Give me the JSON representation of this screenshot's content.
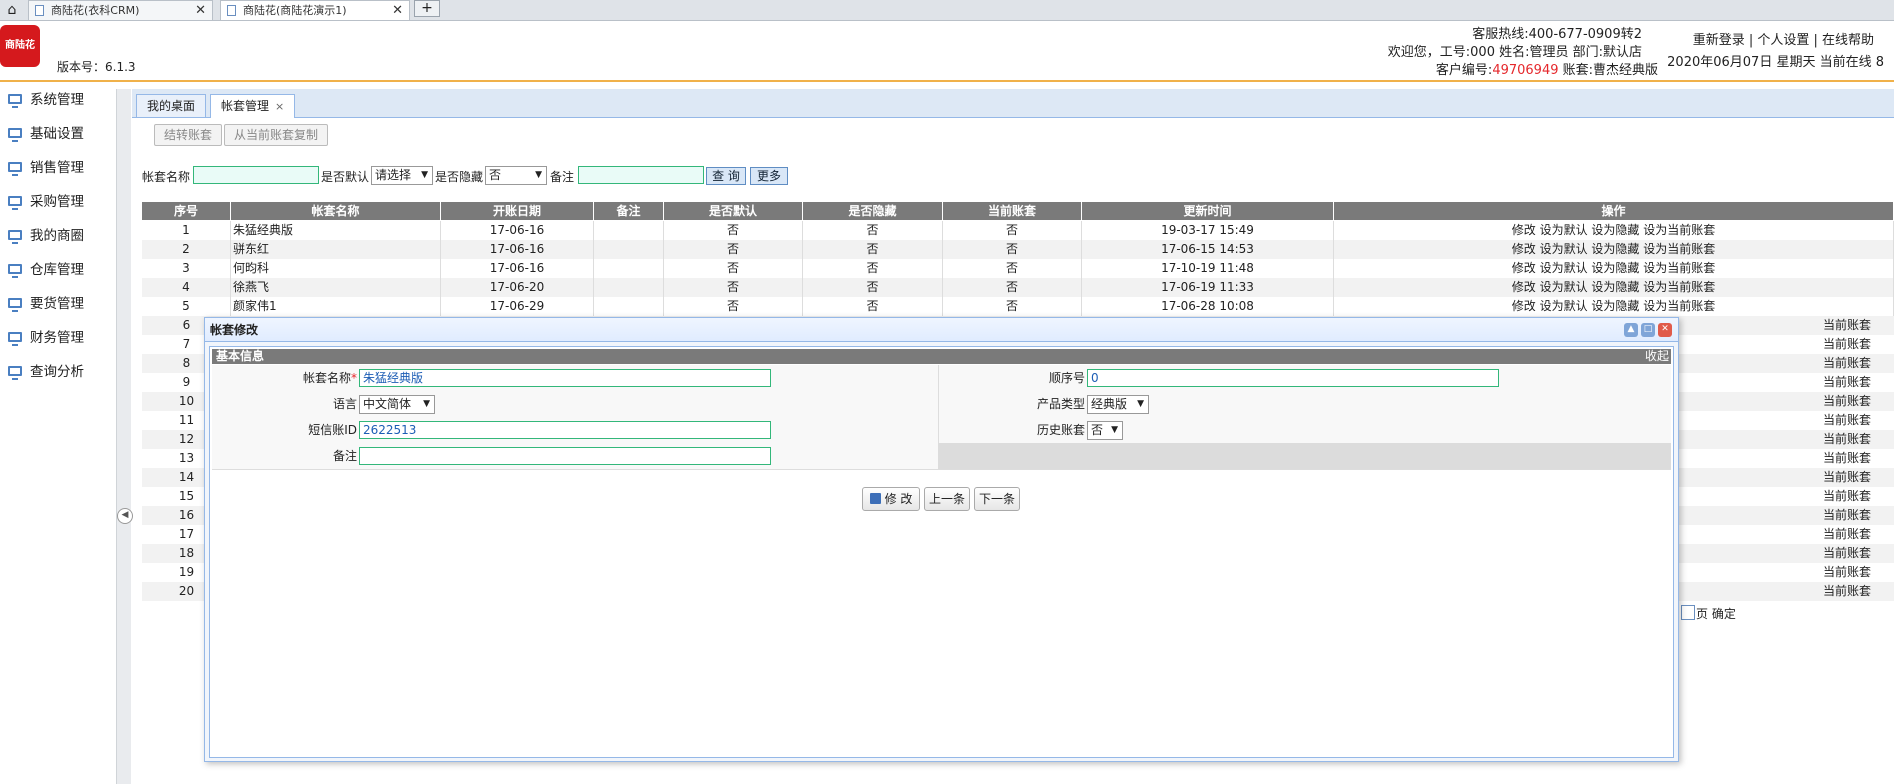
{
  "browser": {
    "tabs": [
      {
        "title": "商陆花(衣科CRM)",
        "active": false
      },
      {
        "title": "商陆花(商陆花演示1)",
        "active": true
      }
    ],
    "new_tab": "+"
  },
  "header": {
    "logo_text": "商陆花",
    "version": "版本号：6.1.3",
    "hotline": "客服热线:400-677-0909转2",
    "welcome": "欢迎您，工号:000 姓名:管理员 部门:默认店",
    "customer_prefix": "客户编号:",
    "customer_id": "49706949",
    "account_set": " 账套:曹杰经典版",
    "links": "重新登录 | 个人设置 | 在线帮助",
    "date_line": "2020年06月07日 星期天 当前在线 8"
  },
  "sidebar": {
    "items": [
      "系统管理",
      "基础设置",
      "销售管理",
      "采购管理",
      "我的商圈",
      "仓库管理",
      "要货管理",
      "财务管理",
      "查询分析"
    ]
  },
  "content_tabs": [
    {
      "label": "我的桌面",
      "active": false
    },
    {
      "label": "帐套管理",
      "active": true,
      "close": "×"
    }
  ],
  "toolbar": {
    "carry_over": "结转账套",
    "copy_from_current": "从当前账套复制"
  },
  "filters": {
    "name_label": "帐套名称",
    "default_label": "是否默认",
    "default_value": "请选择",
    "hidden_label": "是否隐藏",
    "hidden_value": "否",
    "note_label": "备注",
    "query_btn": "查 询",
    "more_btn": "更多"
  },
  "grid": {
    "columns": [
      "序号",
      "帐套名称",
      "开账日期",
      "备注",
      "是否默认",
      "是否隐藏",
      "当前账套",
      "更新时间",
      "操作"
    ],
    "rows": [
      [
        "1",
        "朱猛经典版",
        "17-06-16",
        "",
        "否",
        "否",
        "否",
        "19-03-17 15:49"
      ],
      [
        "2",
        "骈东红",
        "17-06-16",
        "",
        "否",
        "否",
        "否",
        "17-06-15 14:53"
      ],
      [
        "3",
        "何昀科",
        "17-06-16",
        "",
        "否",
        "否",
        "否",
        "17-10-19 11:48"
      ],
      [
        "4",
        "徐燕飞",
        "17-06-20",
        "",
        "否",
        "否",
        "否",
        "17-06-19 11:33"
      ],
      [
        "5",
        "颜家伟1",
        "17-06-29",
        "",
        "否",
        "否",
        "否",
        "17-06-28 10:08"
      ]
    ],
    "op_full": "修改 设为默认 设为隐藏 设为当前账套",
    "op_tail": "当前账套",
    "hidden_row_numbers": [
      "6",
      "7",
      "8",
      "9",
      "10",
      "11",
      "12",
      "13",
      "14",
      "15",
      "16",
      "17",
      "18",
      "19",
      "20"
    ],
    "pager_tail": "页 确定"
  },
  "dialog": {
    "title": "帐套修改",
    "section": "基本信息",
    "collapse": "收起",
    "fields": {
      "name_label": "帐套名称",
      "required_mark": "*",
      "name_value": "朱猛经典版",
      "order_label": "顺序号",
      "order_value": "0",
      "lang_label": "语言",
      "lang_value": "中文简体",
      "product_label": "产品类型",
      "product_value": "经典版",
      "sms_label": "短信账ID",
      "sms_value": "2622513",
      "history_label": "历史账套",
      "history_value": "否",
      "note_label": "备注",
      "note_value": ""
    },
    "buttons": {
      "modify": "修 改",
      "prev": "上一条",
      "next": "下一条"
    }
  },
  "colors": {
    "accent_orange": "#f0b14a",
    "logo_red": "#d5191d",
    "grid_header": "#7a7a7a",
    "input_border": "#33b77a",
    "panel_border": "#95b8e7"
  }
}
